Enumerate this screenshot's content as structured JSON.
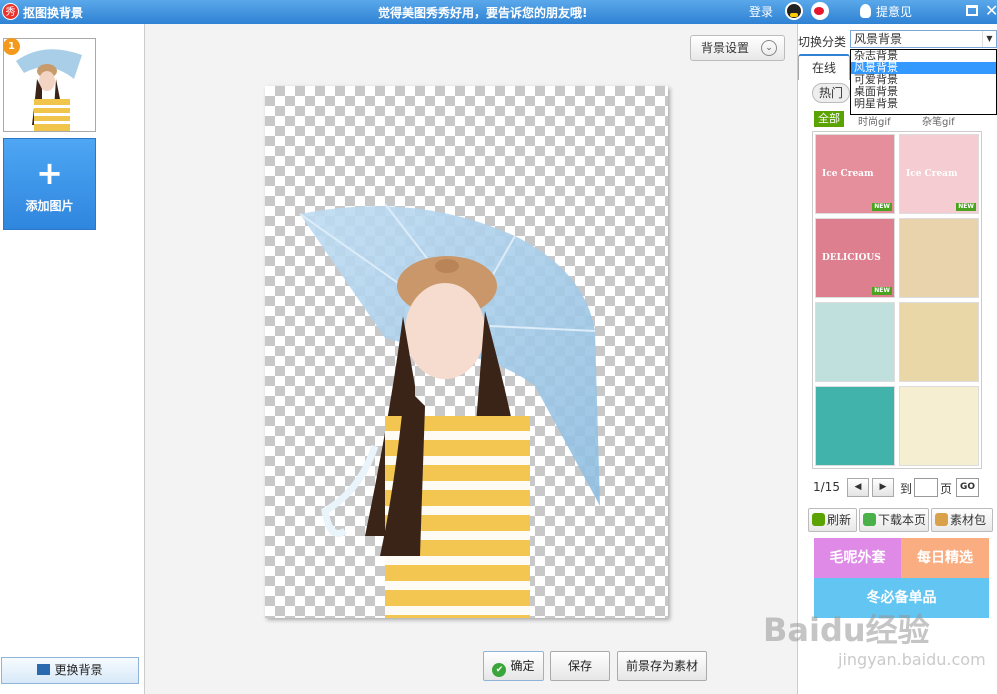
{
  "titlebar": {
    "app_icon_text": "秀",
    "title": "抠图换背景",
    "slogan": "觉得美图秀秀好用，要告诉您的朋友哦!",
    "login": "登录",
    "feedback": "提意见"
  },
  "left": {
    "thumb_number": "1",
    "add_label": "添加图片",
    "add_symbol": "+",
    "change_bg": "更换背景"
  },
  "canvas": {
    "bg_settings": "背景设置",
    "confirm": "确定",
    "save": "保存",
    "save_foreground": "前景存为素材"
  },
  "right": {
    "category_label": "切换分类",
    "category_selected": "风景背景",
    "category_options": [
      "杂志背景",
      "风景背景",
      "可爱背景",
      "桌面背景",
      "明星背景"
    ],
    "tab_online": "在线",
    "hot": "热门",
    "all": "全部",
    "subtabs": [
      "时尚gif",
      "杂笔gif"
    ],
    "tiles": [
      {
        "new": "NEW",
        "caption": "Ice Cream",
        "color": "#e58f9d"
      },
      {
        "new": "NEW",
        "caption": "Ice Cream",
        "color": "#f4ccd1"
      },
      {
        "new": "NEW",
        "caption": "DELICIOUS",
        "color": "#dd7f8f"
      },
      {
        "new": "",
        "caption": "",
        "color": "#e9d3ad"
      },
      {
        "new": "",
        "caption": "",
        "color": "#bfe0dc"
      },
      {
        "new": "",
        "caption": "",
        "color": "#ead7a8"
      },
      {
        "new": "",
        "caption": "",
        "color": "#41b3aa"
      },
      {
        "new": "",
        "caption": "",
        "color": "#f6eed0"
      }
    ],
    "page_info": "1/15",
    "prev": "◀",
    "next": "▶",
    "to": "到",
    "page_unit": "页",
    "go": "GO",
    "refresh": "刷新",
    "download_page": "下载本页",
    "material_pack": "素材包",
    "banner": [
      "毛呢外套",
      "每日精选",
      "冬必备单品"
    ]
  },
  "watermark": {
    "text": "Baidu经验",
    "url": "jingyan.baidu.com"
  }
}
